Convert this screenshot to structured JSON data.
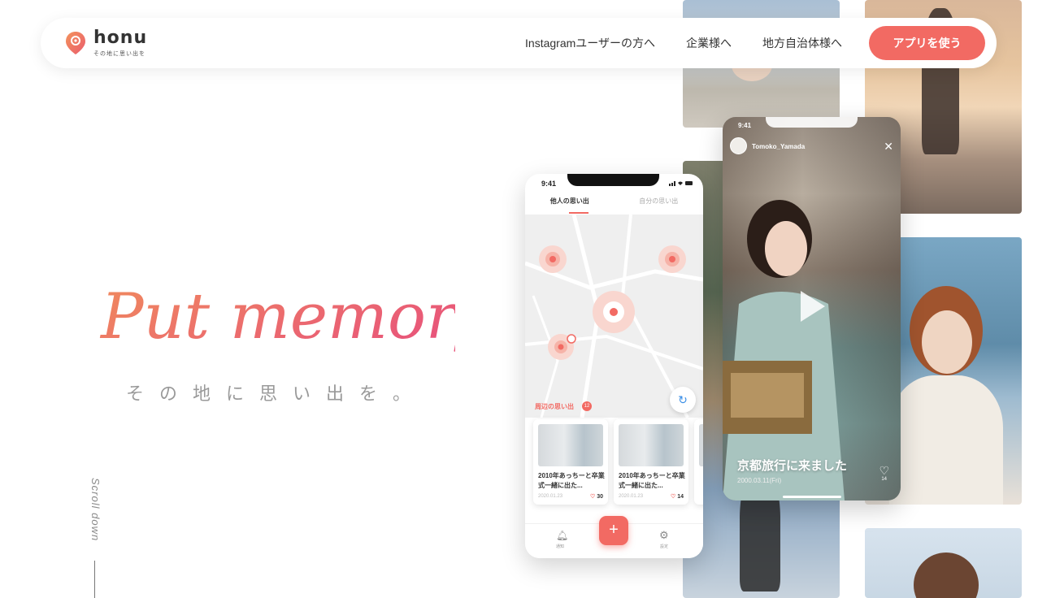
{
  "header": {
    "logo_word": "honu",
    "logo_tagline": "その地に思い出を",
    "nav": [
      "Instagramユーザーの方へ",
      "企業様へ",
      "地方自治体様へ"
    ],
    "cta_label": "アプリを使う"
  },
  "hero": {
    "title": "Put memory",
    "subtitle": "その地に思い出を。",
    "scroll_label": "Scroll down"
  },
  "phone_map": {
    "time": "9:41",
    "tabs": [
      "他人の思い出",
      "自分の思い出"
    ],
    "section_title": "周辺の思い出",
    "section_count": "12",
    "cards": [
      {
        "title": "2010年あっちーと卒業式一緒に出た...",
        "date": "2020.01.23",
        "likes": "30"
      },
      {
        "title": "2010年あっちーと卒業式一緒に出た...",
        "date": "2020.01.23",
        "likes": "14"
      }
    ],
    "nav_notify": "通知",
    "nav_settings": "設定",
    "plus": "+"
  },
  "phone_story": {
    "time": "9:41",
    "username": "Tomoko_Yamada",
    "caption": "京都旅行に来ました",
    "date": "2000.03.11(Fri)",
    "likes": "14"
  },
  "colors": {
    "accent": "#f26a63",
    "title_gradient_start": "#f08a5d",
    "title_gradient_end": "#e8557a"
  }
}
